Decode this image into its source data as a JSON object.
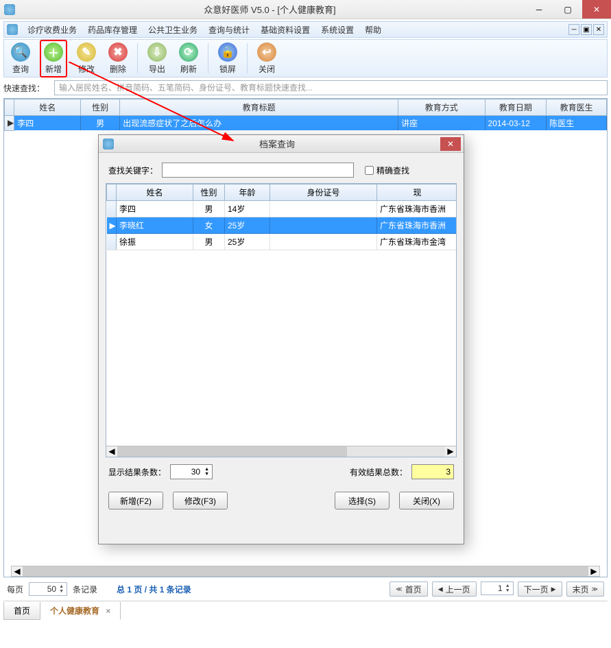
{
  "window": {
    "title": "众意好医师 V5.0 - [个人健康教育]"
  },
  "menu": {
    "items": [
      "诊疗收费业务",
      "药品库存管理",
      "公共卫生业务",
      "查询与统计",
      "基础资料设置",
      "系统设置",
      "帮助"
    ]
  },
  "toolbar": {
    "query": "查询",
    "add": "新增",
    "edit": "修改",
    "delete": "删除",
    "export": "导出",
    "refresh": "刷新",
    "lock": "锁屏",
    "close": "关闭"
  },
  "quicksearch": {
    "label": "快速查找：",
    "placeholder": "输入居民姓名、拼音简码、五笔简码、身份证号、教育标题快速查找..."
  },
  "main_table": {
    "headers": {
      "name": "姓名",
      "sex": "性别",
      "title": "教育标题",
      "method": "教育方式",
      "date": "教育日期",
      "doctor": "教育医生"
    },
    "rows": [
      {
        "name": "李四",
        "sex": "男",
        "title": "出现流感症状了之后怎么办",
        "method": "讲座",
        "date": "2014-03-12",
        "doctor": "陈医生"
      }
    ]
  },
  "pagination": {
    "per_page_label": "每页",
    "per_page_value": "50",
    "records_label": "条记录",
    "summary": "总 1 页 / 共 1 条记录",
    "first": "首页",
    "prev": "上一页",
    "next": "下一页",
    "last": "末页",
    "page_value": "1"
  },
  "bottom_tabs": {
    "home": "首页",
    "active": "个人健康教育"
  },
  "dialog": {
    "title": "档案查询",
    "keyword_label": "查找关键字：",
    "exact_label": "精确查找",
    "headers": {
      "name": "姓名",
      "sex": "性别",
      "age": "年龄",
      "id": "身份证号",
      "addr": "现"
    },
    "rows": [
      {
        "name": "李四",
        "sex": "男",
        "age": "14岁",
        "id": "",
        "addr": "广东省珠海市香洲"
      },
      {
        "name": "李晓红",
        "sex": "女",
        "age": "25岁",
        "id": "",
        "addr": "广东省珠海市香洲"
      },
      {
        "name": "徐振",
        "sex": "男",
        "age": "25岁",
        "id": "",
        "addr": "广东省珠海市金湾"
      }
    ],
    "display_count_label": "显示结果条数：",
    "display_count_value": "30",
    "valid_count_label": "有效结果总数：",
    "valid_count_value": "3",
    "btn_add": "新增(F2)",
    "btn_edit": "修改(F3)",
    "btn_select": "选择(S)",
    "btn_close": "关闭(X)"
  }
}
